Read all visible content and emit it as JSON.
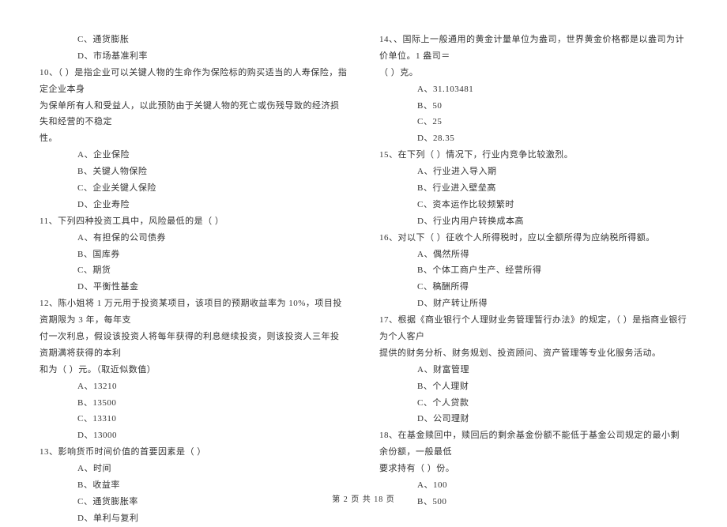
{
  "left": {
    "q9_options": [
      "C、通货膨胀",
      "D、市场基准利率"
    ],
    "q10_text": "10、（     ）是指企业可以关键人物的生命作为保险标的购买适当的人寿保险，指定企业本身",
    "q10_cont1": "为保单所有人和受益人，以此预防由于关键人物的死亡或伤残导致的经济损失和经营的不稳定",
    "q10_cont2": "性。",
    "q10_options": [
      "A、企业保险",
      "B、关键人物保险",
      "C、企业关键人保险",
      "D、企业寿险"
    ],
    "q11_text": "11、下列四种投资工具中，风险最低的是（     ）",
    "q11_options": [
      "A、有担保的公司债券",
      "B、国库券",
      "C、期货",
      "D、平衡性基金"
    ],
    "q12_text": "12、陈小姐将 1 万元用于投资某项目，该项目的预期收益率为 10%，项目投资期限为 3 年，每年支",
    "q12_cont1": "付一次利息，假设该投资人将每年获得的利息继续投资，则该投资人三年投资期满将获得的本利",
    "q12_cont2": "和为（    ）元。（取近似数值）",
    "q12_options": [
      "A、13210",
      "B、13500",
      "C、13310",
      "D、13000"
    ],
    "q13_text": "13、影响货币时间价值的首要因素是（     ）",
    "q13_options": [
      "A、时间",
      "B、收益率",
      "C、通货膨胀率",
      "D、单利与复利"
    ]
  },
  "right": {
    "q14_text": "14、、国际上一般通用的黄金计量单位为盎司，世界黄金价格都是以盎司为计价单位。1 盎司＝",
    "q14_cont1": "（     ）克。",
    "q14_options": [
      "A、31.103481",
      "B、50",
      "C、25",
      "D、28.35"
    ],
    "q15_text": "15、在下列（     ）情况下，行业内竞争比较激烈。",
    "q15_options": [
      "A、行业进入导入期",
      "B、行业进入壁垒高",
      "C、资本运作比较频繁时",
      "D、行业内用户转换成本高"
    ],
    "q16_text": "16、对以下（     ）征收个人所得税时，应以全额所得为应纳税所得额。",
    "q16_options": [
      "A、偶然所得",
      "B、个体工商户生产、经营所得",
      "C、稿酬所得",
      "D、财产转让所得"
    ],
    "q17_text": "17、根据《商业银行个人理财业务管理暂行办法》的规定，（     ）是指商业银行为个人客户",
    "q17_cont1": "提供的财务分析、财务规划、投资顾问、资产管理等专业化服务活动。",
    "q17_options": [
      "A、财富管理",
      "B、个人理财",
      "C、个人贷款",
      "D、公司理财"
    ],
    "q18_text": "18、在基金赎回中，赎回后的剩余基金份额不能低于基金公司规定的最小剩余份额，一般最低",
    "q18_cont1": "要求持有（     ）份。",
    "q18_options": [
      "A、100",
      "B、500"
    ]
  },
  "footer": "第 2 页 共 18 页"
}
